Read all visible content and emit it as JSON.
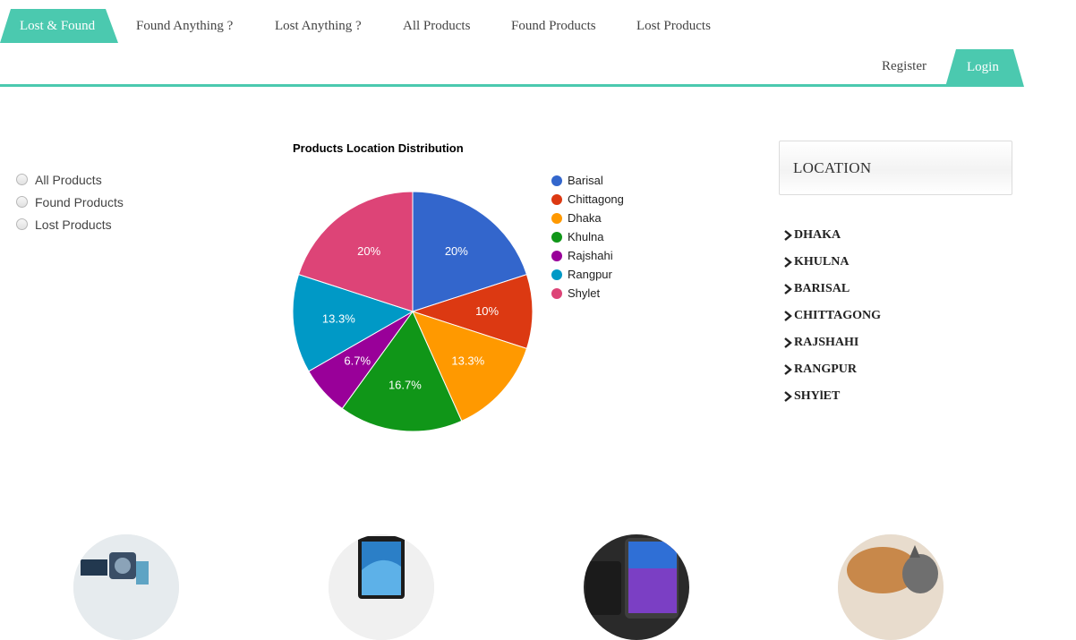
{
  "nav": {
    "brand": "Lost & Found",
    "items": [
      "Found Anything ?",
      "Lost Anything ?",
      "All Products",
      "Found Products",
      "Lost Products"
    ],
    "register": "Register",
    "login": "Login",
    "accent_color": "#4bc9af"
  },
  "filters": {
    "options": [
      "All Products",
      "Found Products",
      "Lost Products"
    ],
    "selected": null
  },
  "chart_data": {
    "type": "pie",
    "title": "Products Location Distribution",
    "categories": [
      "Barisal",
      "Chittagong",
      "Dhaka",
      "Khulna",
      "Rajshahi",
      "Rangpur",
      "Shylet"
    ],
    "values": [
      20,
      10,
      13.3,
      16.7,
      6.7,
      13.3,
      20
    ],
    "labels": [
      "20%",
      "10%",
      "13.3%",
      "16.7%",
      "6.7%",
      "13.3%",
      "20%"
    ],
    "colors": [
      "#3366cc",
      "#dc3912",
      "#ff9900",
      "#109618",
      "#990099",
      "#0099c6",
      "#dd4477"
    ],
    "legend_position": "right"
  },
  "location": {
    "title": "LOCATION",
    "items": [
      "DHAKA",
      "KHULNA",
      "BARISAL",
      "CHITTAGONG",
      "RAJSHAHI",
      "RANGPUR",
      "SHYlET"
    ]
  },
  "products": {
    "thumbnails": [
      "camera-product-image",
      "tablet-product-image",
      "smartphone-product-image",
      "cat-product-image"
    ]
  }
}
